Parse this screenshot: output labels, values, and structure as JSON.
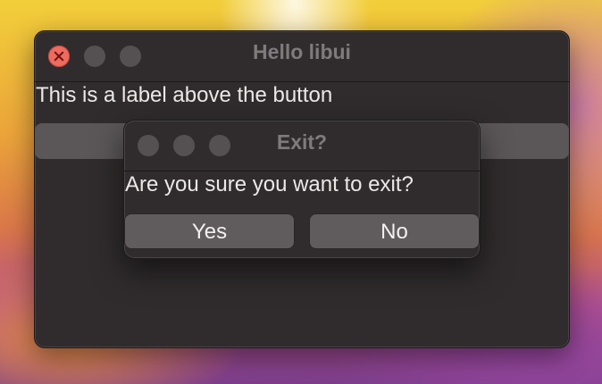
{
  "main_window": {
    "title": "Hello libui",
    "label": "This is a label above the button",
    "button_label": ""
  },
  "dialog": {
    "title": "Exit?",
    "message": "Are you sure you want to exit?",
    "yes_label": "Yes",
    "no_label": "No"
  },
  "colors": {
    "window_bg": "#302c2d",
    "close_button": "#ee6b60",
    "inactive_traffic": "#555152",
    "button_bg": "#605c5d",
    "text": "#ebe8e8"
  },
  "icons": {
    "close": "close-icon",
    "minimize": "minimize-icon",
    "zoom": "zoom-icon"
  }
}
